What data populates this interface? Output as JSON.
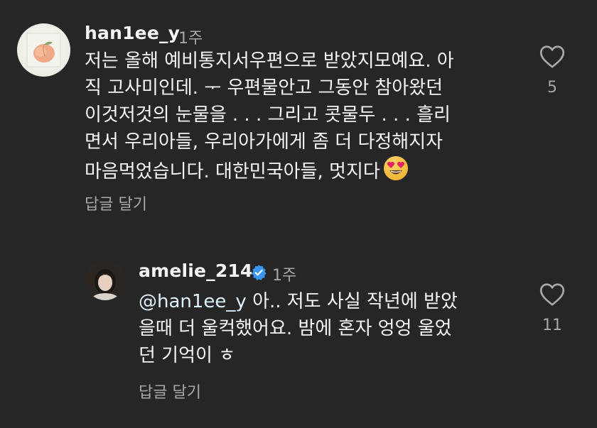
{
  "comments": [
    {
      "username": "han1ee_y",
      "time": "1주",
      "lines": [
        "저는 올해 예비통지서우편으로 받았지모예요. 아",
        "직 고사미인데. ᅮ 우편물안고 그동안 참아왔던",
        "이것저것의 눈물을 . . . 그리고 콧물두 . . . 흘리",
        "면서 우리아들, 우리아가에게 좀 더 다정해지자",
        "마음먹었습니다. 대한민국아들, 멋지다"
      ],
      "emoji": "heart-eyes-emoji",
      "reply_label": "답글 달기",
      "like_count": "5"
    },
    {
      "username": "amelie_214",
      "verified": true,
      "time": "1주",
      "mention": "@han1ee_y",
      "lines": [
        " 아.. 저도 사실 작년에 받았",
        "을때 더 울컥했어요. 밤에 혼자 엉엉 울었",
        "던 기억이 ㅎ"
      ],
      "reply_label": "답글 달기",
      "like_count": "11"
    }
  ],
  "colors": {
    "background": "#262626",
    "text_primary": "#f5f5f5",
    "text_secondary": "#a8a8a8",
    "verified_blue": "#3897f0"
  }
}
